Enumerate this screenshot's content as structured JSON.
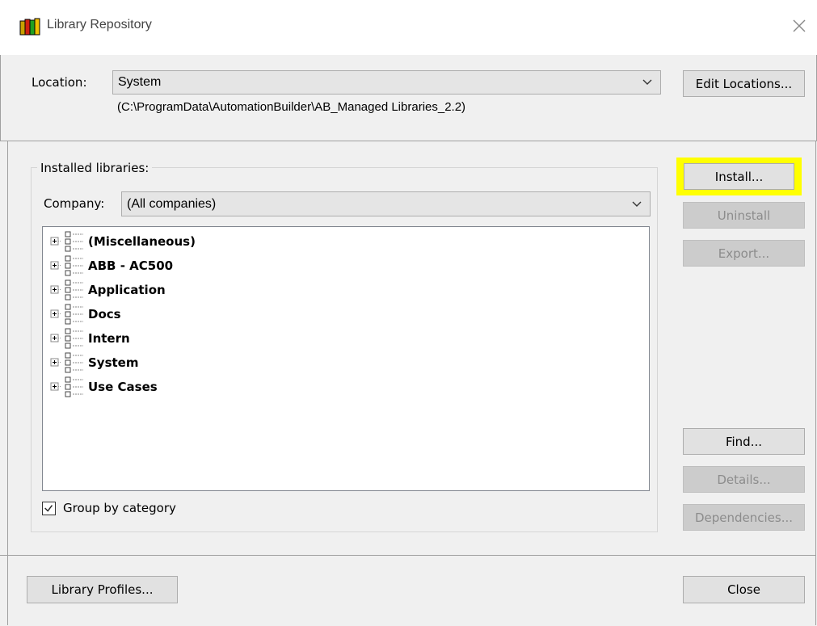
{
  "window": {
    "title": "Library Repository",
    "icon": "library-books-icon",
    "close_icon": "close-icon"
  },
  "location": {
    "label": "Location:",
    "selected": "System",
    "path": "(C:\\ProgramData\\AutomationBuilder\\AB_Managed Libraries_2.2)",
    "edit_button": "Edit Locations..."
  },
  "installed": {
    "group_title": "Installed libraries:",
    "company_label": "Company:",
    "company_selected": "(All companies)",
    "tree_items": [
      "(Miscellaneous)",
      "ABB - AC500",
      "Application",
      "Docs",
      "Intern",
      "System",
      "Use Cases"
    ],
    "group_by_label": "Group by category",
    "group_by_checked": true
  },
  "buttons": {
    "install": "Install...",
    "uninstall": "Uninstall",
    "export": "Export...",
    "find": "Find...",
    "details": "Details...",
    "dependencies": "Dependencies...",
    "library_profiles": "Library Profiles...",
    "close": "Close"
  },
  "colors": {
    "highlight": "#ffff00",
    "disabled_text": "#8c8c8c"
  }
}
